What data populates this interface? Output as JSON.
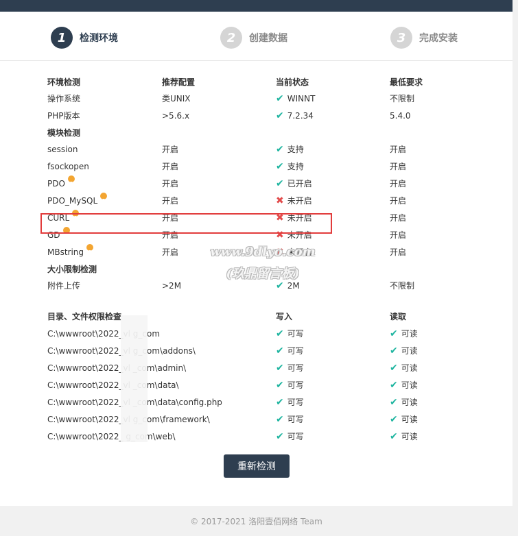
{
  "steps": [
    {
      "num": "1",
      "label": "检测环境"
    },
    {
      "num": "2",
      "label": "创建数据"
    },
    {
      "num": "3",
      "label": "完成安装"
    }
  ],
  "env": {
    "headers": [
      "环境检测",
      "推荐配置",
      "当前状态",
      "最低要求"
    ],
    "rows": [
      {
        "name": "操作系统",
        "rec": "类UNIX",
        "status": "WINNT",
        "min": "不限制"
      },
      {
        "name": "PHP版本",
        "rec": ">5.6.x",
        "status": "7.2.34",
        "min": "5.4.0"
      }
    ]
  },
  "modules": {
    "title": "模块检测",
    "rows": [
      {
        "name": "session",
        "rec": "开启",
        "status": "支持",
        "min": "开启"
      },
      {
        "name": "fsockopen",
        "rec": "开启",
        "status": "支持",
        "min": "开启"
      },
      {
        "name": "PDO",
        "rec": "开启",
        "status": "已开启",
        "min": "开启"
      },
      {
        "name": "PDO_MySQL",
        "rec": "开启",
        "status": "未开启",
        "min": "开启"
      },
      {
        "name": "CURL",
        "rec": "开启",
        "status": "未开启",
        "min": "开启"
      },
      {
        "name": "GD",
        "rec": "开启",
        "status": "未开启",
        "min": "开启"
      },
      {
        "name": "MBstring",
        "rec": "开启",
        "status": "未开启",
        "min": "开启"
      }
    ]
  },
  "size": {
    "title": "大小限制检测",
    "rows": [
      {
        "name": "附件上传",
        "rec": ">2M",
        "status": "2M",
        "min": "不限制"
      }
    ]
  },
  "dirs": {
    "headers": [
      "目录、文件权限检查",
      "写入",
      "读取"
    ],
    "rows": [
      {
        "path": "C:\\wwwroot\\2022_vl    g_com",
        "write": "可写",
        "read": "可读"
      },
      {
        "path": "C:\\wwwroot\\2022_vl    g_com\\addons\\",
        "write": "可写",
        "read": "可读"
      },
      {
        "path": "C:\\wwwroot\\2022_vl    _com\\admin\\",
        "write": "可写",
        "read": "可读"
      },
      {
        "path": "C:\\wwwroot\\2022_vl    _com\\data\\",
        "write": "可写",
        "read": "可读"
      },
      {
        "path": "C:\\wwwroot\\2022_vl    _com\\data\\config.php",
        "write": "可写",
        "read": "可读"
      },
      {
        "path": "C:\\wwwroot\\2022_vl    g_com\\framework\\",
        "write": "可写",
        "read": "可读"
      },
      {
        "path": "C:\\wwwroot\\2022_    g_com\\web\\",
        "write": "可写",
        "read": "可读"
      }
    ]
  },
  "watermark": {
    "line1": "www.9dlyo.com",
    "line2": "(玖鼎留言板)"
  },
  "button": {
    "label": "重新检测"
  },
  "footer": {
    "text": "© 2017-2021 洛阳壹佰网络 Team"
  },
  "icons": {
    "ok": "check-icon",
    "fail": "cross-icon",
    "help": "question-icon"
  },
  "colors": {
    "ok": "#1fb5a0",
    "fail": "#e24a4a",
    "help": "#f3a531",
    "dark": "#2e3e50"
  }
}
